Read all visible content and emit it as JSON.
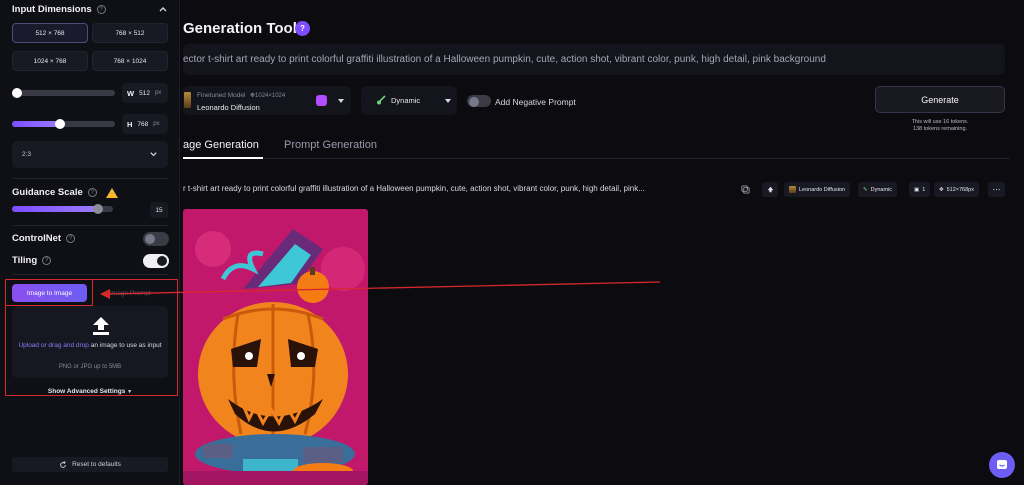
{
  "sidebar": {
    "input_dimensions": {
      "title": "Input Dimensions",
      "sizes": [
        "512 × 768",
        "768 × 512",
        "1024 × 768",
        "768 × 1024"
      ],
      "width_label": "W",
      "width_value": "512",
      "height_label": "H",
      "height_value": "768",
      "unit": "px",
      "width_fraction": 0.0,
      "height_fraction": 0.47,
      "aspect_ratio": "2:3"
    },
    "guidance": {
      "title": "Guidance Scale",
      "value": "15",
      "fraction": 0.85
    },
    "controlnet": {
      "label": "ControlNet",
      "on": false
    },
    "tiling": {
      "label": "Tiling",
      "on": true
    },
    "image_to_image": {
      "button": "Image to Image",
      "image_prompt_tab": "Image Prompt",
      "upload_link": "Upload or drag and drop",
      "upload_text": " an image to use as input",
      "upload_sub": "PNG or JPG up to 5MB",
      "advanced": "Show Advanced Settings"
    },
    "reset_label": "Reset to defaults"
  },
  "main": {
    "title": "Generation Tool",
    "prompt": "ector t-shirt art ready to print colorful graffiti illustration of a Halloween pumpkin, cute, action shot, vibrant color, punk, high detail, pink background",
    "model": {
      "kicker": "Finetuned Model",
      "resolution": "1024×1024",
      "name": "Leonardo Diffusion"
    },
    "style": {
      "name": "Dynamic"
    },
    "negative_prompt": {
      "label": "Add Negative Prompt",
      "on": false
    },
    "generate": {
      "label": "Generate",
      "note_line1": "This will use 16 tokens.",
      "note_line2": "138 tokens remaining."
    },
    "tabs": [
      {
        "label": "age Generation",
        "active": true
      },
      {
        "label": "Prompt Generation",
        "active": false
      }
    ],
    "generation": {
      "prompt": "r t-shirt art ready to print colorful graffiti illustration of a Halloween pumpkin, cute, action shot, vibrant color, punk, high detail, pink...",
      "chips": {
        "model": "Leonardo Diffusion",
        "style": "Dynamic",
        "count": "1",
        "size": "512×768px"
      }
    }
  },
  "colors": {
    "accent": "#7c4dff",
    "annotation_red": "#d8282b",
    "warning": "#f5b72b",
    "background": "#0b0b10"
  }
}
